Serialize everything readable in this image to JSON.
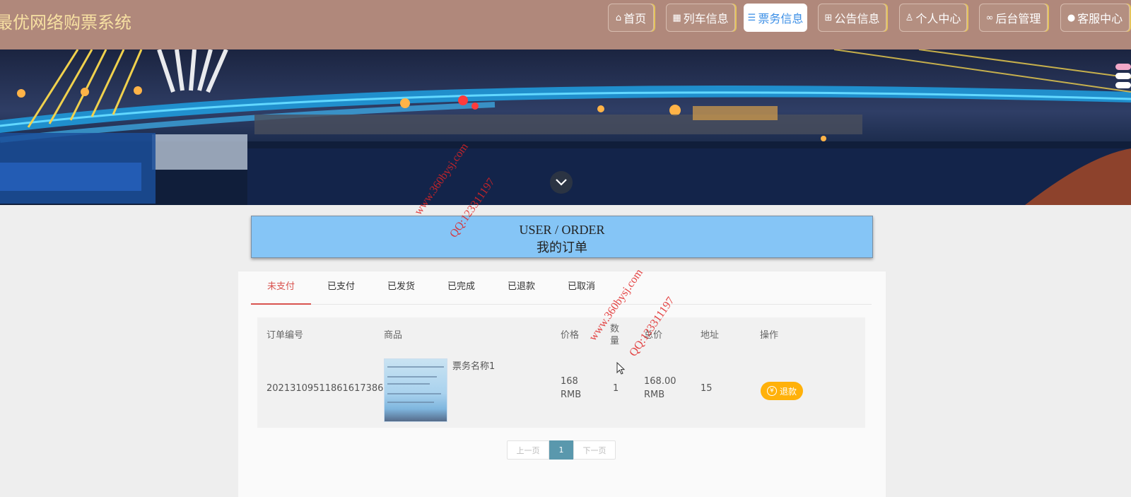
{
  "header": {
    "app_title": "最优网络购票系统",
    "nav": [
      {
        "label": "首页",
        "icon": "home-icon"
      },
      {
        "label": "列车信息",
        "icon": "grid-icon"
      },
      {
        "label": "票务信息",
        "icon": "sliders-icon"
      },
      {
        "label": "公告信息",
        "icon": "gift-icon"
      },
      {
        "label": "个人中心",
        "icon": "user-icon"
      },
      {
        "label": "后台管理",
        "icon": "link-icon"
      },
      {
        "label": "客服中心",
        "icon": "chat-icon"
      }
    ],
    "active_nav": "票务信息"
  },
  "page_title": {
    "en": "USER / ORDER",
    "cn": "我的订单"
  },
  "tabs": [
    "未支付",
    "已支付",
    "已发货",
    "已完成",
    "已退款",
    "已取消"
  ],
  "active_tab": "未支付",
  "table": {
    "headers": {
      "order_no": "订单编号",
      "product": "商品",
      "price": "价格",
      "qty": "数量",
      "total": "总价",
      "address": "地址",
      "action": "操作"
    },
    "rows": [
      {
        "order_no": "20213109511861617386",
        "product_name": "票务名称1",
        "price": "168 RMB",
        "qty": "1",
        "total": "168.00 RMB",
        "address": "15",
        "action_label": "退款"
      }
    ]
  },
  "pager": {
    "prev": "上一页",
    "current": "1",
    "next": "下一页"
  },
  "watermarks": {
    "site": "www.360bysj.com",
    "qq": "QQ:123311197"
  },
  "colors": {
    "header_bg": "#b0887b",
    "logo_text": "#f7e0a2",
    "title_box": "#85c5f6",
    "active_tab": "#d9534f",
    "refund_button": "#ffb10a",
    "pager_current": "#5a98ad"
  }
}
